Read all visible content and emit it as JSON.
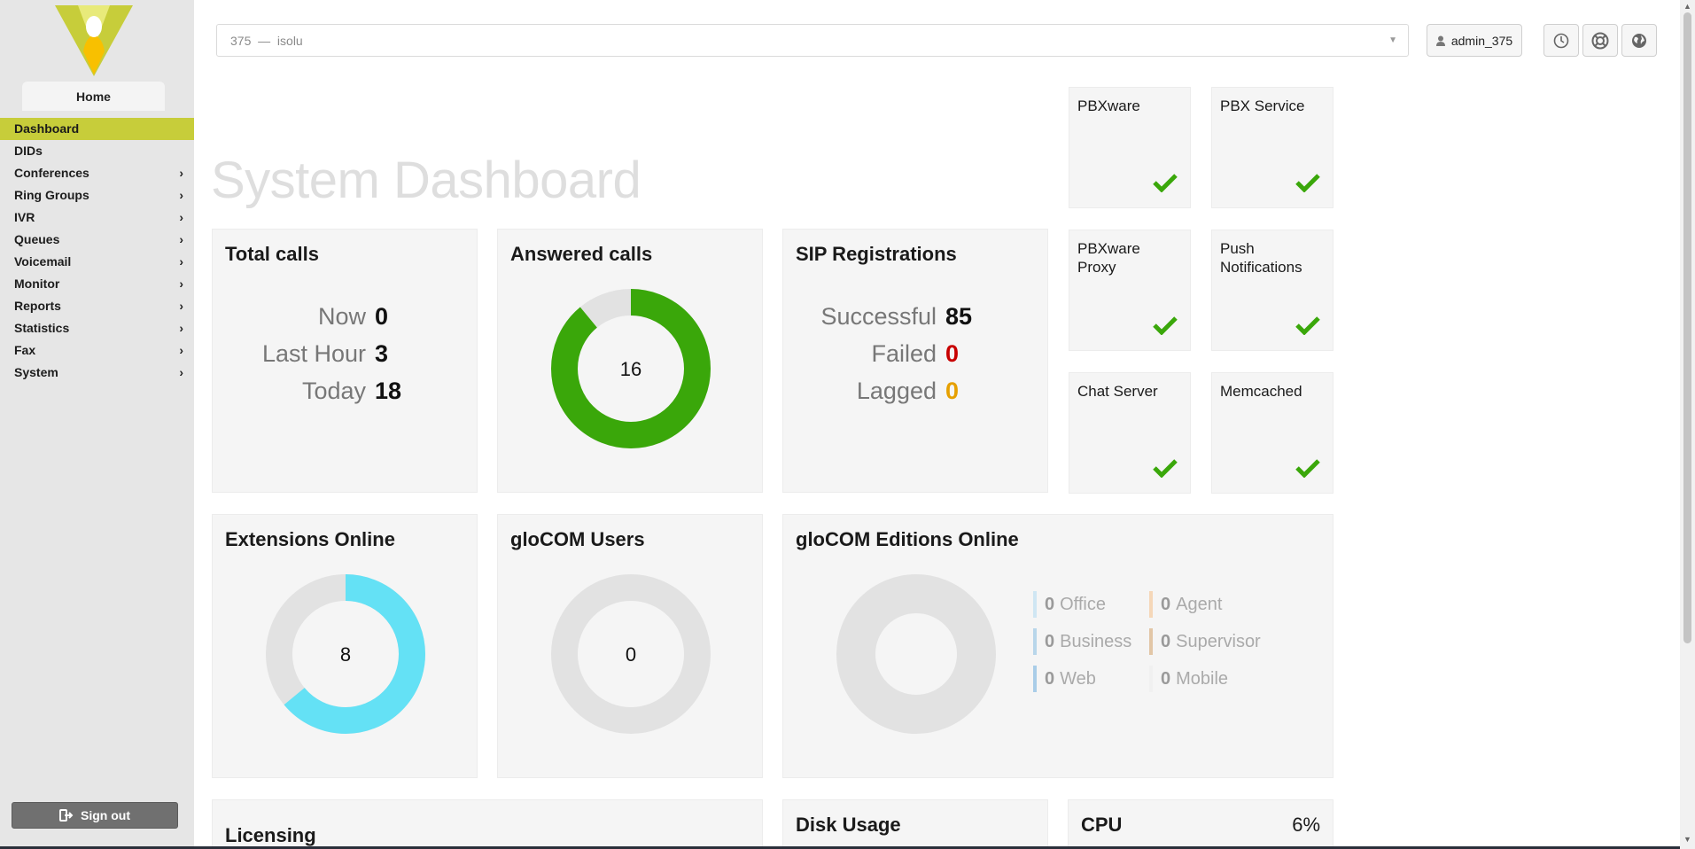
{
  "sidebar": {
    "home_tab": "Home",
    "items": [
      {
        "label": "Dashboard",
        "active": true,
        "has_children": false
      },
      {
        "label": "DIDs",
        "active": false,
        "has_children": false
      },
      {
        "label": "Conferences",
        "active": false,
        "has_children": true
      },
      {
        "label": "Ring Groups",
        "active": false,
        "has_children": true
      },
      {
        "label": "IVR",
        "active": false,
        "has_children": true
      },
      {
        "label": "Queues",
        "active": false,
        "has_children": true
      },
      {
        "label": "Voicemail",
        "active": false,
        "has_children": true
      },
      {
        "label": "Monitor",
        "active": false,
        "has_children": true
      },
      {
        "label": "Reports",
        "active": false,
        "has_children": true
      },
      {
        "label": "Statistics",
        "active": false,
        "has_children": true
      },
      {
        "label": "Fax",
        "active": false,
        "has_children": true
      },
      {
        "label": "System",
        "active": false,
        "has_children": true
      }
    ],
    "signout_label": "Sign out"
  },
  "topbar": {
    "tenant_value": "375  —  isolu",
    "user_label": "admin_375"
  },
  "page_title": "System Dashboard",
  "total_calls": {
    "title": "Total calls",
    "rows": [
      {
        "label": "Now",
        "value": "0"
      },
      {
        "label": "Last Hour",
        "value": "3"
      },
      {
        "label": "Today",
        "value": "18"
      }
    ]
  },
  "answered_calls": {
    "title": "Answered calls",
    "center": "16",
    "fraction": 0.89,
    "color": "#3aa70a"
  },
  "sip": {
    "title": "SIP Registrations",
    "rows": [
      {
        "label": "Successful",
        "value": "85",
        "color": "#111111"
      },
      {
        "label": "Failed",
        "value": "0",
        "color": "#c80000"
      },
      {
        "label": "Lagged",
        "value": "0",
        "color": "#e6a000"
      }
    ]
  },
  "status_tiles": [
    {
      "name": "PBXware"
    },
    {
      "name": "PBX Service"
    },
    {
      "name": "PBXware\nProxy"
    },
    {
      "name": "Push\nNotifications"
    },
    {
      "name": "Chat Server"
    },
    {
      "name": "Memcached"
    }
  ],
  "extensions_online": {
    "title": "Extensions Online",
    "center": "8",
    "fraction": 0.64,
    "color": "#64e1f5"
  },
  "glocom_users": {
    "title": "gloCOM Users",
    "center": "0",
    "fraction": 0
  },
  "glocom_editions": {
    "title": "gloCOM Editions Online",
    "items": [
      {
        "value": "0",
        "label": "Office",
        "color": "#cfe6f3"
      },
      {
        "value": "0",
        "label": "Business",
        "color": "#b8d6ea"
      },
      {
        "value": "0",
        "label": "Web",
        "color": "#a9cde8"
      },
      {
        "value": "0",
        "label": "Agent",
        "color": "#f5d7b8"
      },
      {
        "value": "0",
        "label": "Supervisor",
        "color": "#e2c6a6"
      },
      {
        "value": "0",
        "label": "Mobile",
        "color": "#f0f0f0"
      }
    ]
  },
  "licensing": {
    "title": "Licensing"
  },
  "disk_usage": {
    "title": "Disk Usage"
  },
  "cpu": {
    "title": "CPU",
    "value": "6%"
  },
  "colors": {
    "accent": "#c7cd3a",
    "check": "#3aa70a",
    "donut_empty": "#e2e2e2"
  }
}
